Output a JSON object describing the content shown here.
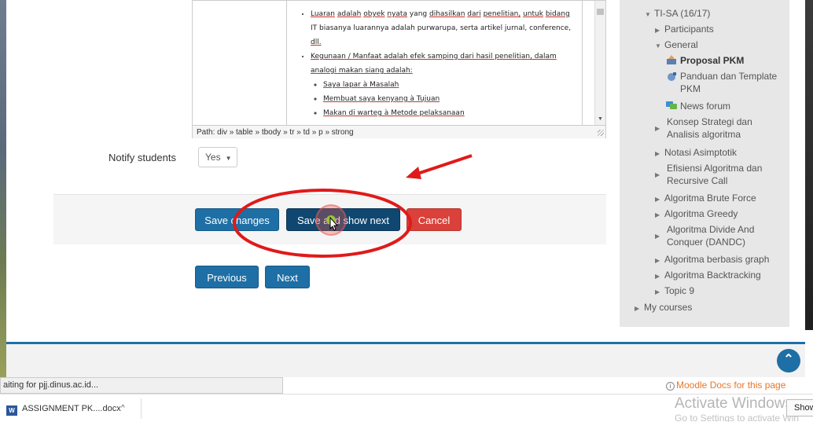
{
  "editor": {
    "bullets": {
      "b1": [
        "Luaran",
        "adalah",
        "obyek",
        "nyata",
        "yang",
        "dihasilkan",
        "dari",
        "penelitian,",
        "untuk",
        "bidang"
      ],
      "b1_line2": "IT biasanya luarannya adalah purwarupa, serta artikel jurnal, conference,",
      "b1_line3": "dll.",
      "b2_line1": "Kegunaan / Manfaat adalah efek samping dari hasil penelitian, dalam",
      "b2_line2": "analogi makan siang adalah:",
      "sub": [
        "Saya lapar à Masalah",
        "Membuat saya kenyang à Tujuan",
        "Makan di warteg à Metode pelaksanaan"
      ]
    },
    "path": "Path: div » table » tbody » tr » td » p » strong"
  },
  "form": {
    "notify_label": "Notify students",
    "notify_value": "Yes",
    "save_changes": "Save changes",
    "save_show_next": "Save and show next",
    "cancel": "Cancel",
    "previous": "Previous",
    "next": "Next"
  },
  "sidebar": {
    "course": "TI-SA (16/17)",
    "items": [
      "Participants",
      "General",
      "Proposal PKM",
      "Panduan dan Template PKM",
      "News forum",
      "Konsep Strategi dan Analisis algoritma",
      "Notasi Asimptotik",
      "Efisiensi Algoritma dan Recursive Call",
      "Algoritma Brute Force",
      "Algoritma Greedy",
      "Algoritma Divide And Conquer (DANDC)",
      "Algoritma berbasis graph",
      "Algoritma Backtracking",
      "Topic 9"
    ],
    "my_courses": "My courses"
  },
  "status": {
    "text": "aiting for pjj.dinus.ac.id...",
    "moodle_docs": "Moodle Docs for this page"
  },
  "downloads": {
    "file": "ASSIGNMENT PK....docx",
    "show_all": "Show"
  },
  "watermark": {
    "title": "Activate Windows",
    "subtitle": "Go to Settings to activate Win"
  },
  "icons": {
    "back_to_top": "chevron-up-icon",
    "file_word": "word-icon"
  },
  "colors": {
    "primary": "#1e6fa5",
    "dark": "#0f4770",
    "danger": "#d9413a",
    "annotation": "#e01a1a",
    "link_orange": "#e8762c"
  }
}
